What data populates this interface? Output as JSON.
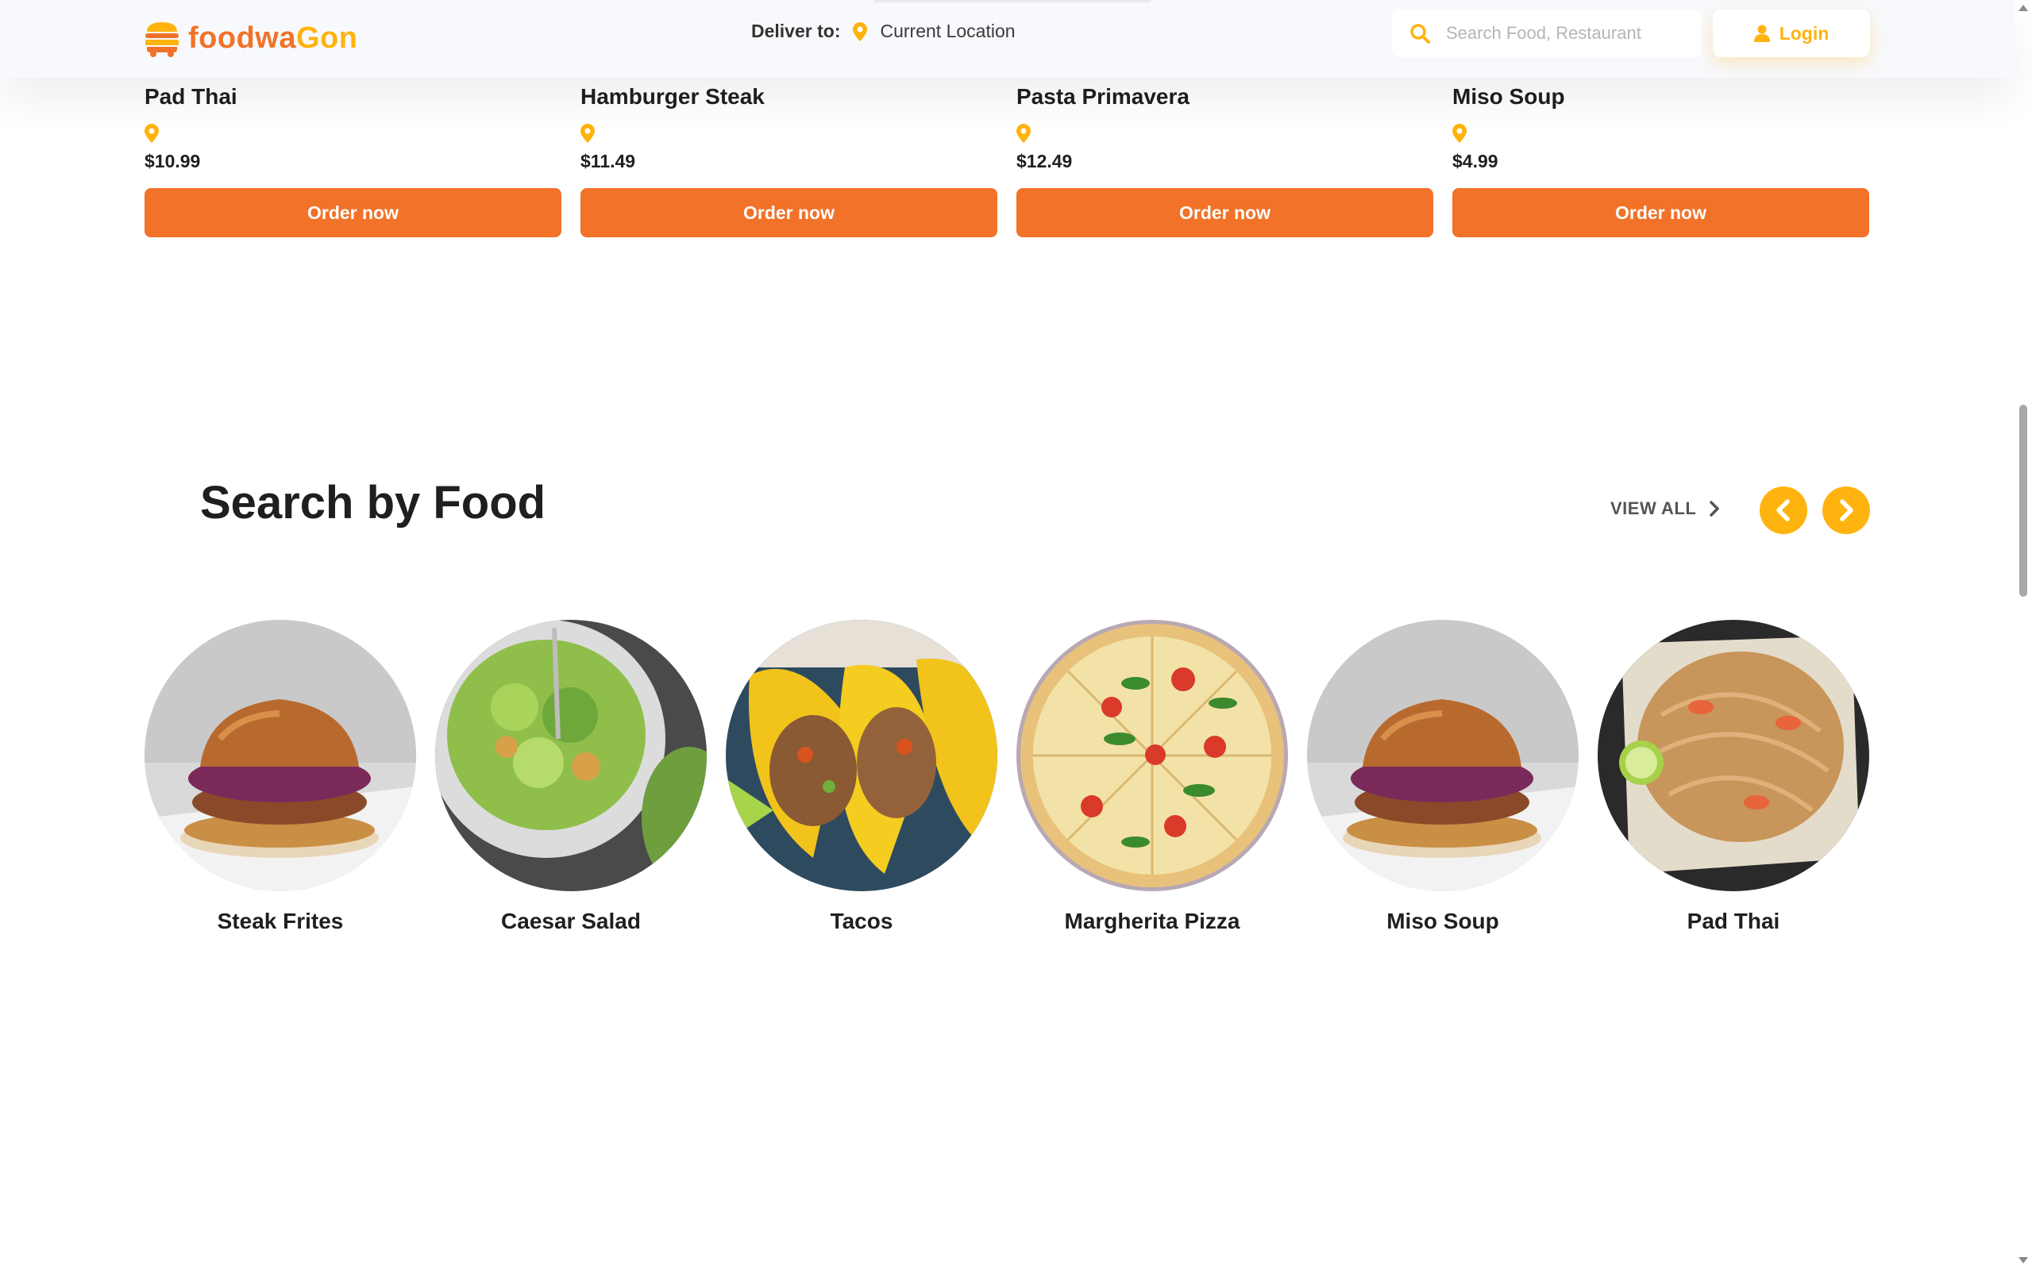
{
  "header": {
    "brand": {
      "part1": "foodwa",
      "part2": "Gon"
    },
    "deliver_label": "Deliver to:",
    "deliver_value": "Current Location",
    "search_placeholder": "Search Food, Restaurant",
    "login_label": "Login",
    "icons": {
      "logo": "burger-truck-icon",
      "deliver": "map-pin-icon",
      "search": "search-icon",
      "login": "user-icon"
    }
  },
  "colors": {
    "primary_orange": "#f17228",
    "accent_yellow": "#ffb30e",
    "text_dark": "#1f1f1f",
    "header_bg": "#f8f9fc"
  },
  "food_cards": [
    {
      "name": "Pad Thai",
      "price": "$10.99",
      "button": "Order now"
    },
    {
      "name": "Hamburger Steak",
      "price": "$11.49",
      "button": "Order now"
    },
    {
      "name": "Pasta Primavera",
      "price": "$12.49",
      "button": "Order now"
    },
    {
      "name": "Miso Soup",
      "price": "$4.99",
      "button": "Order now"
    }
  ],
  "search_by_food": {
    "title": "Search by Food",
    "view_all": "VIEW ALL",
    "prev_icon": "chevron-left-icon",
    "next_icon": "chevron-right-icon",
    "items": [
      {
        "name": "Steak Frites",
        "image": "burger"
      },
      {
        "name": "Caesar Salad",
        "image": "salad"
      },
      {
        "name": "Tacos",
        "image": "tacos"
      },
      {
        "name": "Margherita Pizza",
        "image": "pizza"
      },
      {
        "name": "Miso Soup",
        "image": "burger"
      },
      {
        "name": "Pad Thai",
        "image": "noodles"
      }
    ]
  }
}
